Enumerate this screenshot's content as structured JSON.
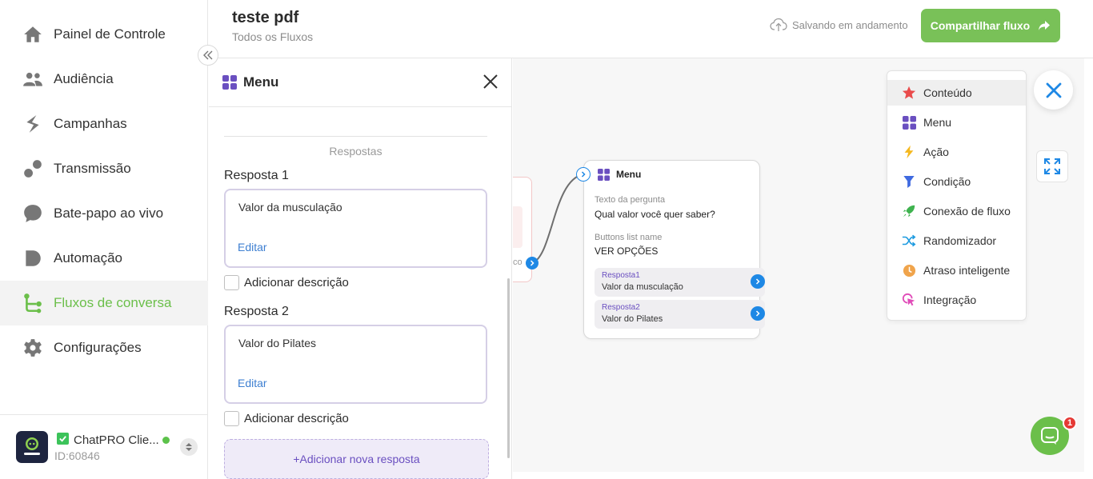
{
  "sidebar": {
    "items": [
      {
        "label": "Painel de Controle",
        "icon": "home-icon"
      },
      {
        "label": "Audiência",
        "icon": "people-icon"
      },
      {
        "label": "Campanhas",
        "icon": "campaign-icon"
      },
      {
        "label": "Transmissão",
        "icon": "broadcast-icon"
      },
      {
        "label": "Bate-papo ao vivo",
        "icon": "chat-bubble-icon"
      },
      {
        "label": "Automação",
        "icon": "automation-icon"
      },
      {
        "label": "Fluxos de conversa",
        "icon": "flow-icon"
      },
      {
        "label": "Configurações",
        "icon": "gear-icon"
      }
    ],
    "active_index": 6,
    "account": {
      "name": "ChatPRO Clie...",
      "id": "ID:60846",
      "avatar_text": "ChatPRO",
      "status": "online"
    }
  },
  "header": {
    "title": "teste pdf",
    "breadcrumb": "Todos os Fluxos",
    "save_status": "Salvando em andamento",
    "share_label": "Compartilhar fluxo"
  },
  "panel": {
    "title": "Menu",
    "section_label": "Respostas",
    "responses": [
      {
        "label": "Resposta 1",
        "value": "Valor da musculação",
        "edit": "Editar",
        "description_label": "Adicionar descrição"
      },
      {
        "label": "Resposta 2",
        "value": "Valor do Pilates",
        "edit": "Editar",
        "description_label": "Adicionar descrição"
      }
    ],
    "add_response_label": "+Adicionar nova resposta"
  },
  "canvas": {
    "prev_node_fragment": "co",
    "menu_node": {
      "title": "Menu",
      "question_label": "Texto da pergunta",
      "question_value": "Qual valor você quer saber?",
      "buttons_label": "Buttons list name",
      "buttons_value": "VER OPÇÕES",
      "responses": [
        {
          "label": "Resposta1",
          "value": "Valor da musculação"
        },
        {
          "label": "Resposta2",
          "value": "Valor do Pilates"
        }
      ]
    },
    "block_menu": [
      {
        "label": "Conteúdo",
        "icon": "star-icon"
      },
      {
        "label": "Menu",
        "icon": "grid-icon"
      },
      {
        "label": "Ação",
        "icon": "bolt-icon"
      },
      {
        "label": "Condição",
        "icon": "filter-icon"
      },
      {
        "label": "Conexão de fluxo",
        "icon": "rocket-icon"
      },
      {
        "label": "Randomizador",
        "icon": "shuffle-icon"
      },
      {
        "label": "Atraso inteligente",
        "icon": "clock-icon"
      },
      {
        "label": "Integração",
        "icon": "cursor-click-icon"
      }
    ],
    "chat_badge": "1"
  },
  "colors": {
    "brand_green": "#79c158",
    "active_green": "#6bbf4a",
    "purple": "#6a4fc0",
    "link_blue": "#1e88e5"
  }
}
